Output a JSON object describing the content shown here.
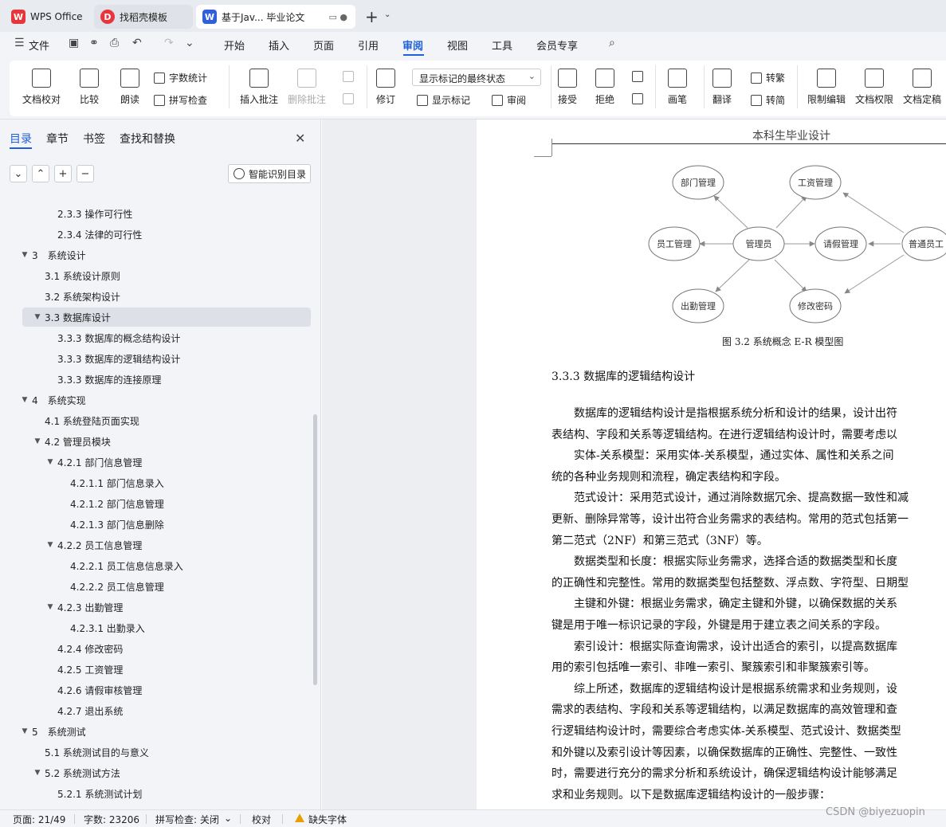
{
  "tabs": {
    "wps": "WPS Office",
    "templates": "找稻壳模板",
    "doc": "基于Jav... 毕业论文",
    "plus": "+"
  },
  "menu": {
    "file": "文件",
    "items": [
      "开始",
      "插入",
      "页面",
      "引用",
      "审阅",
      "视图",
      "工具",
      "会员专享"
    ]
  },
  "ribbon": {
    "doc_proof": "文档校对",
    "compare": "比较",
    "read_aloud": "朗读",
    "word_count": "字数统计",
    "spell_check": "拼写检查",
    "insert_comment": "插入批注",
    "delete_comment": "删除批注",
    "revise": "修订",
    "markup_select": "显示标记的最终状态",
    "show_markup": "显示标记",
    "review": "审阅",
    "accept": "接受",
    "reject": "拒绝",
    "pen": "画笔",
    "translate": "翻译",
    "to_traditional": "转繁",
    "to_simplified": "转简",
    "restrict_edit": "限制编辑",
    "doc_permission": "文档权限",
    "doc_finalize": "文档定稿"
  },
  "nav": {
    "tabs": [
      "目录",
      "章节",
      "书签",
      "查找和替换"
    ],
    "smart_toc": "智能识别目录",
    "toc": [
      {
        "label": "2.3.3 操作可行性",
        "level": 3,
        "arrow": ""
      },
      {
        "label": "2.3.4 法律的可行性",
        "level": 3,
        "arrow": ""
      },
      {
        "label": "3　系统设计",
        "level": 1,
        "arrow": "▼"
      },
      {
        "label": "3.1 系统设计原则",
        "level": 2,
        "arrow": ""
      },
      {
        "label": "3.2 系统架构设计",
        "level": 2,
        "arrow": ""
      },
      {
        "label": "3.3 数据库设计",
        "level": 2,
        "arrow": "▼",
        "selected": true
      },
      {
        "label": "3.3.3 数据库的概念结构设计",
        "level": 3,
        "arrow": ""
      },
      {
        "label": "3.3.3 数据库的逻辑结构设计",
        "level": 3,
        "arrow": ""
      },
      {
        "label": "3.3.3 数据库的连接原理",
        "level": 3,
        "arrow": ""
      },
      {
        "label": "4　系统实现",
        "level": 1,
        "arrow": "▼"
      },
      {
        "label": "4.1 系统登陆页面实现",
        "level": 2,
        "arrow": ""
      },
      {
        "label": "4.2 管理员模块",
        "level": 2,
        "arrow": "▼"
      },
      {
        "label": "4.2.1 部门信息管理",
        "level": 3,
        "arrow": "▼"
      },
      {
        "label": "4.2.1.1 部门信息录入",
        "level": 4,
        "arrow": ""
      },
      {
        "label": "4.2.1.2 部门信息管理",
        "level": 4,
        "arrow": ""
      },
      {
        "label": "4.2.1.3 部门信息删除",
        "level": 4,
        "arrow": ""
      },
      {
        "label": "4.2.2 员工信息管理",
        "level": 3,
        "arrow": "▼"
      },
      {
        "label": "4.2.2.1 员工信息信息录入",
        "level": 4,
        "arrow": ""
      },
      {
        "label": "4.2.2.2 员工信息管理",
        "level": 4,
        "arrow": ""
      },
      {
        "label": "4.2.3 出勤管理",
        "level": 3,
        "arrow": "▼"
      },
      {
        "label": "4.2.3.1 出勤录入",
        "level": 4,
        "arrow": ""
      },
      {
        "label": "4.2.4 修改密码",
        "level": 3,
        "arrow": ""
      },
      {
        "label": "4.2.5 工资管理",
        "level": 3,
        "arrow": ""
      },
      {
        "label": "4.2.6 请假审核管理",
        "level": 3,
        "arrow": ""
      },
      {
        "label": "4.2.7 退出系统",
        "level": 3,
        "arrow": ""
      },
      {
        "label": "5　系统测试",
        "level": 1,
        "arrow": "▼"
      },
      {
        "label": "5.1 系统测试目的与意义",
        "level": 2,
        "arrow": ""
      },
      {
        "label": "5.2 系统测试方法",
        "level": 2,
        "arrow": "▼"
      },
      {
        "label": "5.2.1 系统测试计划",
        "level": 3,
        "arrow": ""
      }
    ]
  },
  "doc": {
    "header": "本科生毕业设计",
    "er": {
      "dept": "部门管理",
      "salary": "工资管理",
      "emp": "员工管理",
      "admin": "管理员",
      "leave": "请假管理",
      "staff": "普通员工",
      "attend": "出勤管理",
      "pwd": "修改密码"
    },
    "figure_caption": "图 3.2 系统概念 E-R 模型图",
    "section_title": "3.3.3 数据库的逻辑结构设计",
    "paragraphs": [
      "　　数据库的逻辑结构设计是指根据系统分析和设计的结果，设计出符",
      "表结构、字段和关系等逻辑结构。在进行逻辑结构设计时，需要考虑以",
      "　　实体-关系模型：采用实体-关系模型，通过实体、属性和关系之间",
      "统的各种业务规则和流程，确定表结构和字段。",
      "　　范式设计：采用范式设计，通过消除数据冗余、提高数据一致性和减",
      "更新、删除异常等，设计出符合业务需求的表结构。常用的范式包括第一",
      "第二范式（2NF）和第三范式（3NF）等。",
      "　　数据类型和长度：根据实际业务需求，选择合适的数据类型和长度",
      "的正确性和完整性。常用的数据类型包括整数、浮点数、字符型、日期型",
      "　　主键和外键：根据业务需求，确定主键和外键，以确保数据的关系",
      "键是用于唯一标识记录的字段，外键是用于建立表之间关系的字段。",
      "　　索引设计：根据实际查询需求，设计出适合的索引，以提高数据库",
      "用的索引包括唯一索引、非唯一索引、聚簇索引和非聚簇索引等。",
      "　　综上所述，数据库的逻辑结构设计是根据系统需求和业务规则，设",
      "需求的表结构、字段和关系等逻辑结构，以满足数据库的高效管理和查",
      "行逻辑结构设计时，需要综合考虑实体-关系模型、范式设计、数据类型",
      "和外键以及索引设计等因素，以确保数据库的正确性、完整性、一致性",
      "时，需要进行充分的需求分析和系统设计，确保逻辑结构设计能够满足",
      "求和业务规则。以下是数据库逻辑结构设计的一般步骤："
    ]
  },
  "status": {
    "page": "页面: 21/49",
    "words": "字数: 23206",
    "spell": "拼写检查: 关闭",
    "proof": "校对",
    "missing_font": "缺失字体"
  },
  "watermark": "CSDN @biyezuopin"
}
